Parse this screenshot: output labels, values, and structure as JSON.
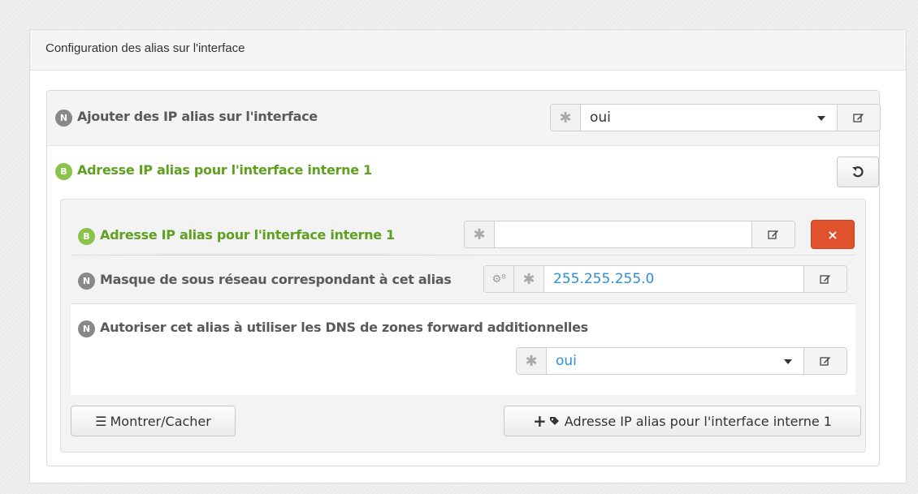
{
  "panel": {
    "title": "Configuration des alias sur l'interface"
  },
  "row_add_alias": {
    "badge": "N",
    "label": "Ajouter des IP alias sur l'interface",
    "value": "oui"
  },
  "section_alias": {
    "badge": "B",
    "label": "Adresse IP alias pour l'interface interne 1"
  },
  "entry": {
    "ip_row": {
      "badge": "B",
      "label": "Adresse IP alias pour l'interface interne 1",
      "value": ""
    },
    "mask_row": {
      "badge": "N",
      "label": "Masque de sous réseau correspondant à cet alias",
      "value": "255.255.255.0"
    },
    "dns_row": {
      "badge": "N",
      "label": "Autoriser cet alias à utiliser les DNS de zones forward additionnelles",
      "value": "oui"
    }
  },
  "buttons": {
    "toggle_label": "Montrer/Cacher",
    "add_label": "Adresse IP alias pour l'interface interne 1",
    "delete_label": "×"
  },
  "icons": {
    "required": "asterisk-icon",
    "edit": "edit-icon",
    "reset": "undo-icon",
    "cogs": "cogs-icon",
    "menu": "bars-icon",
    "plus": "plus-icon",
    "tag": "tag-icon"
  },
  "colors": {
    "green_label": "#5fa021",
    "badge_b": "#8bc34a",
    "badge_n": "#888888",
    "delete_button": "#e0522e",
    "value_blue": "#2f8fd5"
  }
}
